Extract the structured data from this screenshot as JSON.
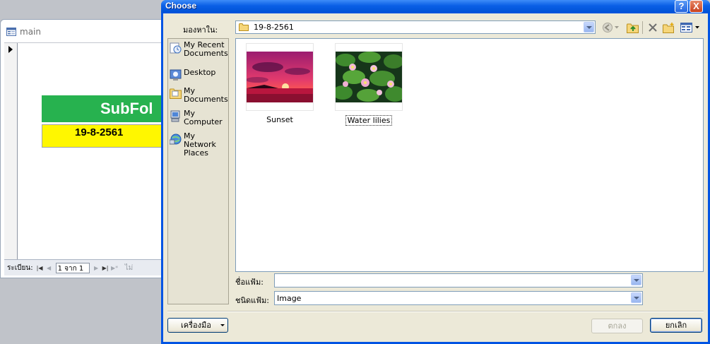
{
  "background_window": {
    "title": "main",
    "subform_title": "SubFol",
    "date_value": "19-8-2561",
    "navigation": {
      "record_label": "ระเบียน:",
      "record_position": "1 จาก 1",
      "extra_text": "ไม่"
    }
  },
  "dialog": {
    "title": "Choose",
    "help_label": "?",
    "close_label": "X",
    "look_in": {
      "label": "มองหาใน:",
      "value": "19-8-2561"
    },
    "places": [
      {
        "label": "My Recent Documents",
        "icon": "recent-documents-icon"
      },
      {
        "label": "Desktop",
        "icon": "desktop-icon"
      },
      {
        "label": "My Documents",
        "icon": "my-documents-icon"
      },
      {
        "label": "My Computer",
        "icon": "my-computer-icon"
      },
      {
        "label": "My Network Places",
        "icon": "network-places-icon"
      }
    ],
    "files": [
      {
        "name": "Sunset",
        "icon": "sunset-thumbnail"
      },
      {
        "name": "Water lilies",
        "icon": "water-lilies-thumbnail"
      }
    ],
    "file_name": {
      "label": "ชื่อแฟ้ม:",
      "value": ""
    },
    "file_type": {
      "label": "ชนิดแฟ้ม:",
      "value": "Image"
    },
    "buttons": {
      "tools": "เครื่องมือ",
      "ok": "ตกลง",
      "cancel": "ยกเลิก"
    },
    "toolbar_icons": [
      "back-icon",
      "up-folder-icon",
      "delete-icon",
      "new-folder-icon",
      "views-icon"
    ]
  },
  "colors": {
    "subform_green": "#27b24f",
    "date_yellow": "#fff700",
    "xp_blue": "#0054e3",
    "dialog_face": "#ece9d8"
  }
}
